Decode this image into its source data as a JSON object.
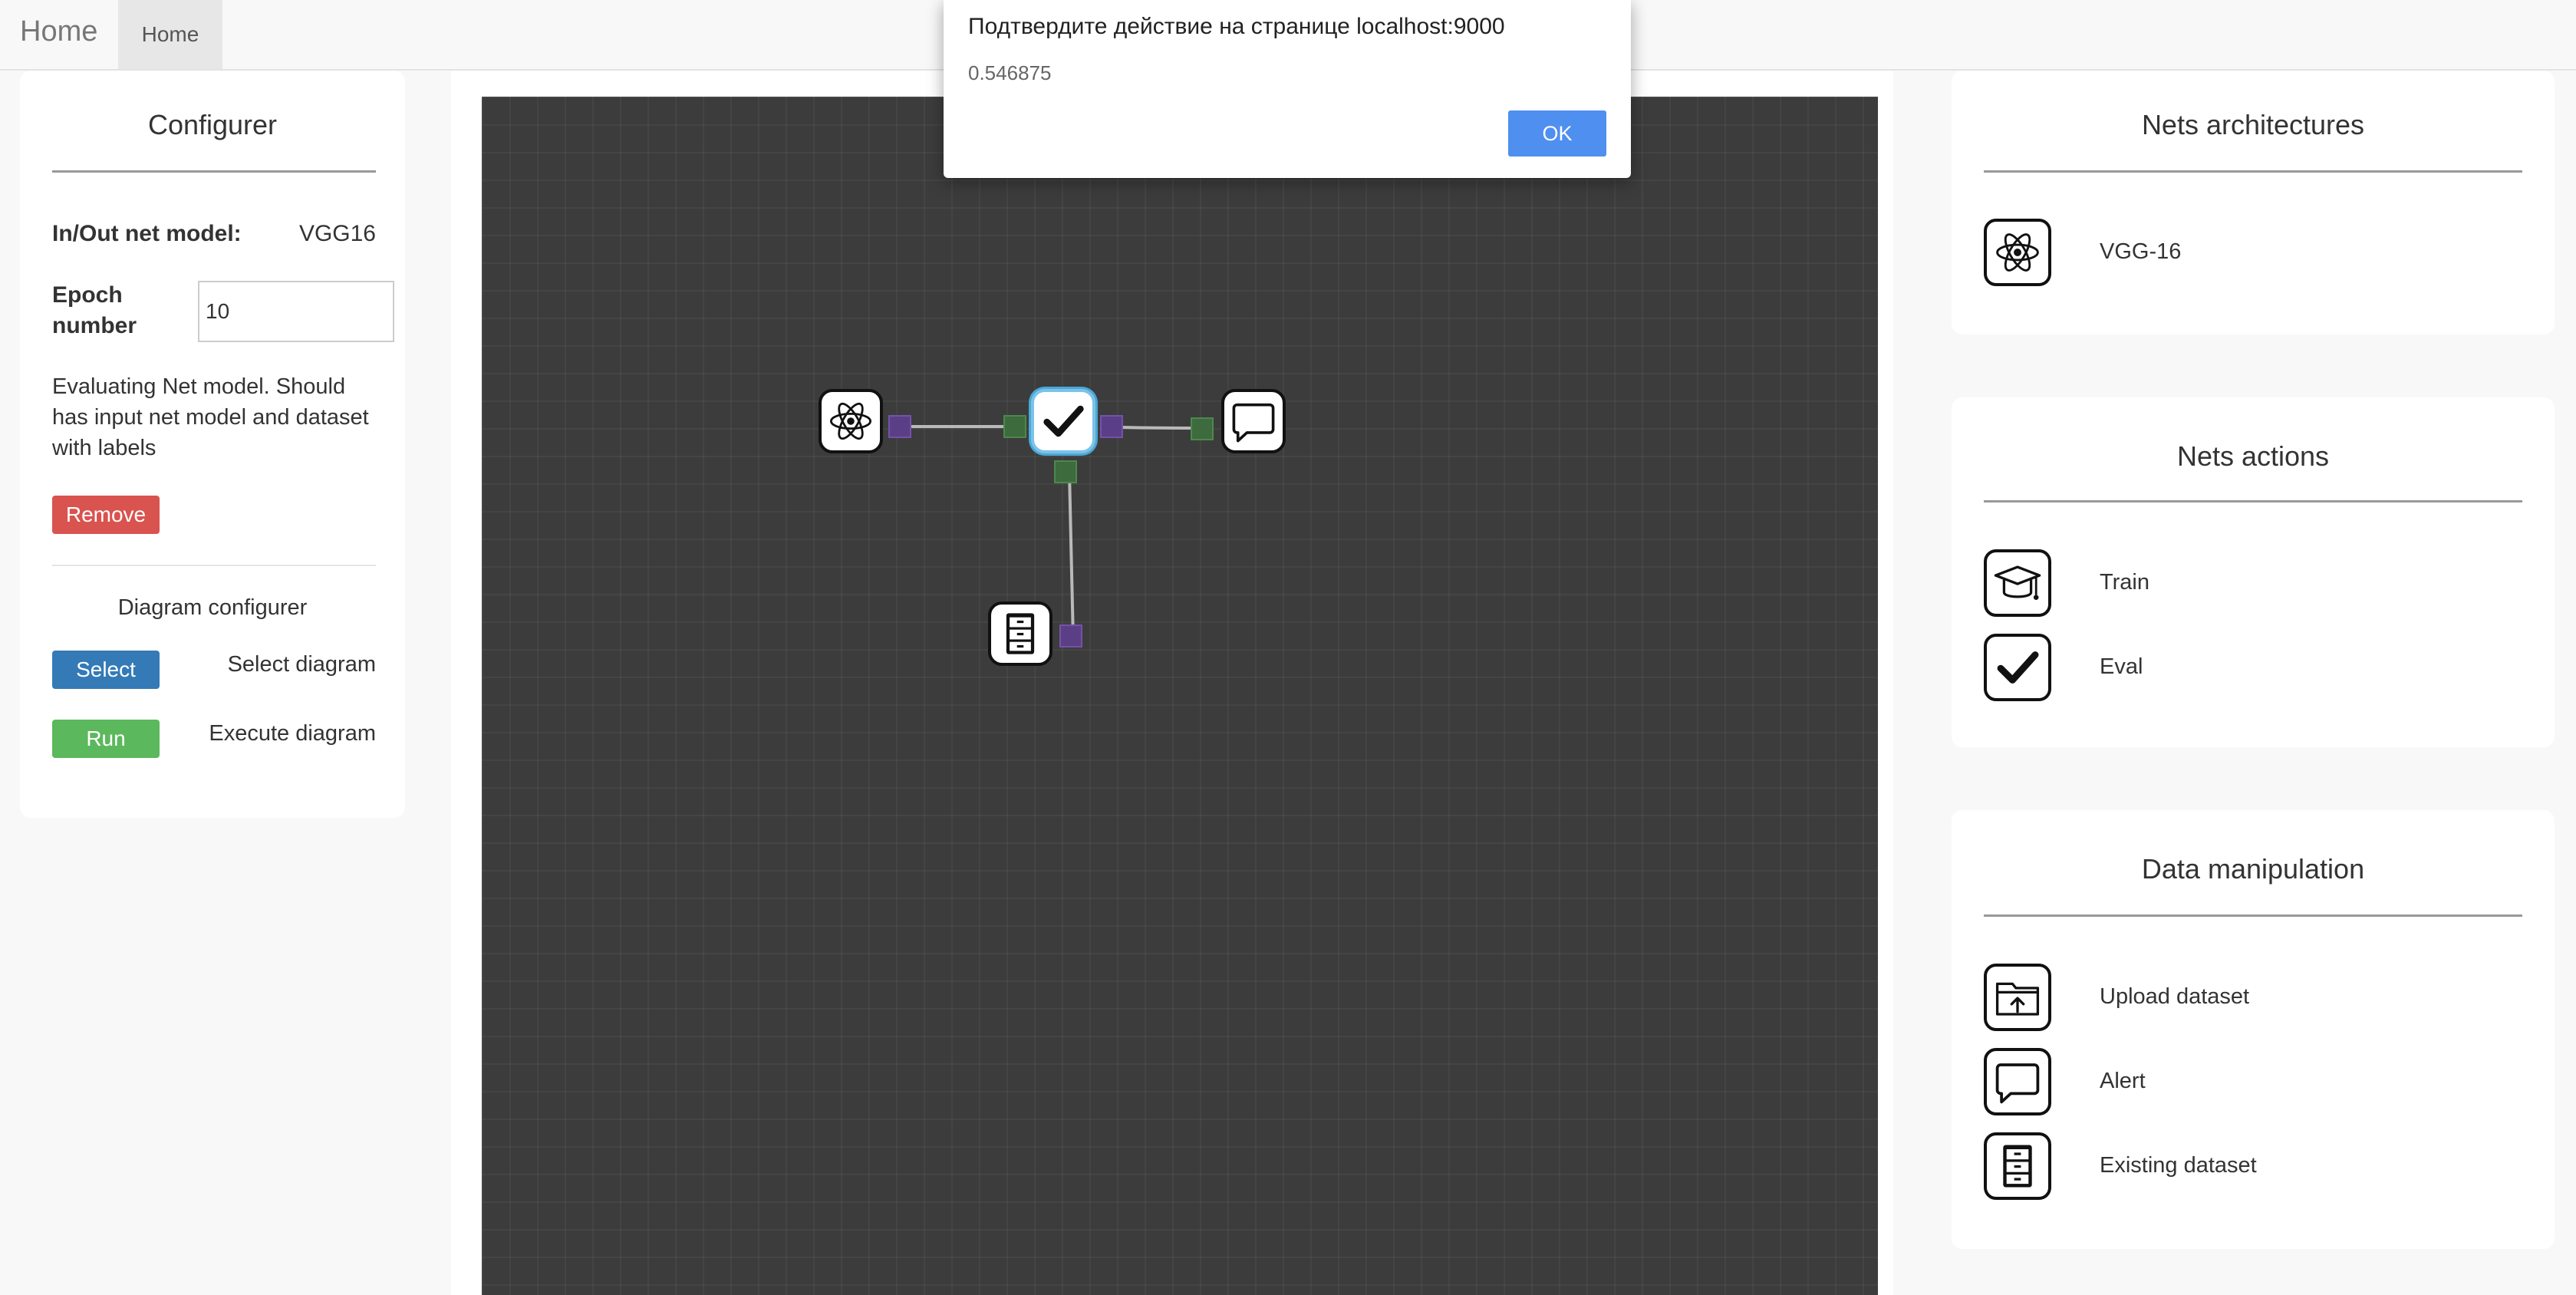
{
  "navbar": {
    "brand": "Home",
    "tab": "Home"
  },
  "configurer": {
    "title": "Configurer",
    "model_label": "In/Out net model:",
    "model_value": "VGG16",
    "epoch_label_1": "Epoch",
    "epoch_label_2": "number",
    "epoch_value": "10",
    "description_lines": [
      "Evaluating Net model. Should",
      "has input net model and dataset",
      "with labels"
    ],
    "remove_label": "Remove",
    "diagram_title": "Diagram configurer",
    "select_label": "Select",
    "select_desc": "Select diagram",
    "run_label": "Run",
    "run_desc": "Execute diagram"
  },
  "dialog": {
    "title": "Подтвердите действие на странице localhost:9000",
    "message": "0.546875",
    "ok_label": "OK"
  },
  "architectures": {
    "title": "Nets architectures",
    "items": [
      {
        "label": "VGG-16",
        "icon": "atom-icon"
      }
    ]
  },
  "actions": {
    "title": "Nets actions",
    "items": [
      {
        "label": "Train",
        "icon": "graduation-cap-icon"
      },
      {
        "label": "Eval",
        "icon": "checkmark-icon"
      }
    ]
  },
  "data": {
    "title": "Data manipulation",
    "items": [
      {
        "label": "Upload dataset",
        "icon": "folder-upload-icon"
      },
      {
        "label": "Alert",
        "icon": "speech-bubble-icon"
      },
      {
        "label": "Existing dataset",
        "icon": "file-cabinet-icon"
      }
    ]
  },
  "diagram": {
    "nodes": [
      {
        "id": "vgg",
        "icon": "atom-icon"
      },
      {
        "id": "eval",
        "icon": "checkmark-icon",
        "selected": true
      },
      {
        "id": "alert",
        "icon": "speech-bubble-icon"
      },
      {
        "id": "dataset",
        "icon": "file-cabinet-icon"
      }
    ]
  },
  "colors": {
    "remove": "#d9534f",
    "select": "#337ab7",
    "run": "#5cb85c",
    "ok": "#4f8ff0",
    "canvas": "#3c3c3c"
  }
}
